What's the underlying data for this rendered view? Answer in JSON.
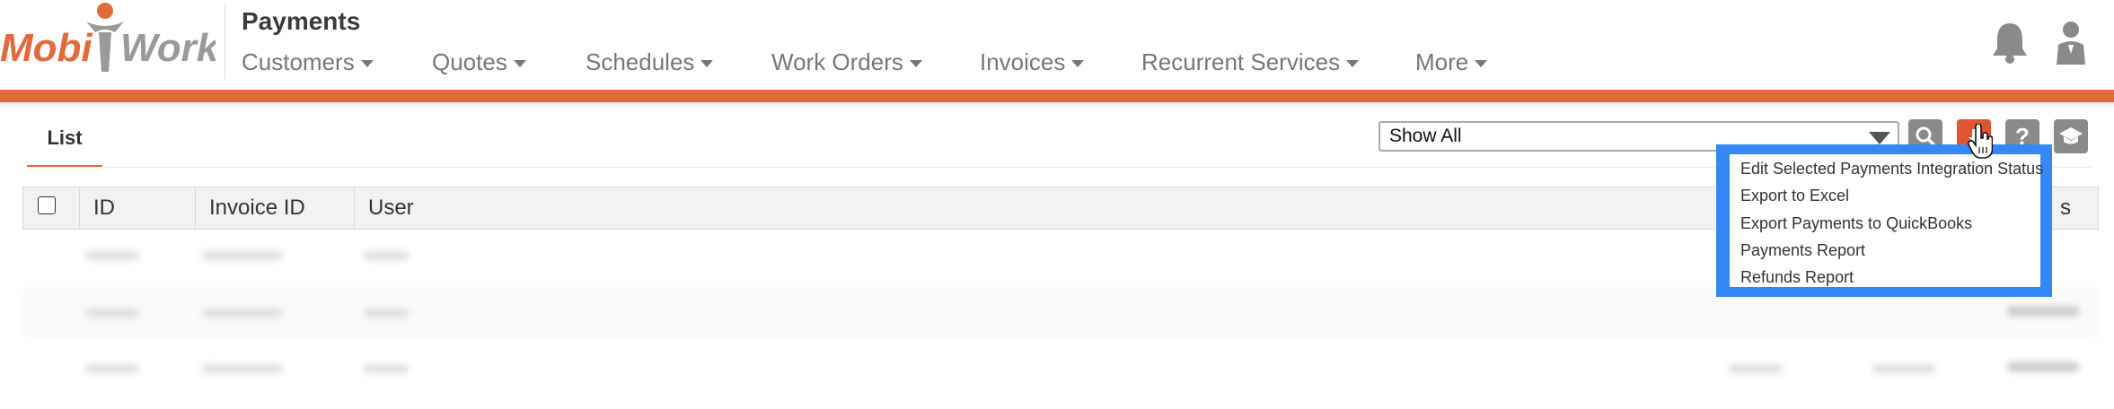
{
  "header": {
    "logo_text": "MobiWork",
    "page_title": "Payments",
    "nav": [
      {
        "label": "Customers"
      },
      {
        "label": "Quotes"
      },
      {
        "label": "Schedules"
      },
      {
        "label": "Work Orders"
      },
      {
        "label": "Invoices"
      },
      {
        "label": "Recurrent Services"
      },
      {
        "label": "More"
      }
    ],
    "icons": [
      "bell-icon",
      "user-icon"
    ]
  },
  "colors": {
    "accent": "#e36a3b",
    "dropdown_highlight": "#3587f5",
    "button_gray": "#8a8a8a",
    "button_orange": "#e0552f"
  },
  "toolbar": {
    "tabs": [
      {
        "label": "List"
      }
    ],
    "filter": {
      "selected": "Show All"
    },
    "buttons": [
      "search-icon",
      "export-icon",
      "help-icon",
      "training-icon"
    ]
  },
  "table": {
    "columns": [
      "ID",
      "Invoice ID",
      "User"
    ],
    "partially_hidden_column_suffix": "s"
  },
  "export_menu": {
    "items": [
      {
        "label": "Edit Selected Payments Integration Status"
      },
      {
        "label": "Export to Excel"
      },
      {
        "label": "Export Payments to QuickBooks"
      },
      {
        "label": "Payments Report"
      },
      {
        "label": "Refunds Report"
      }
    ]
  }
}
